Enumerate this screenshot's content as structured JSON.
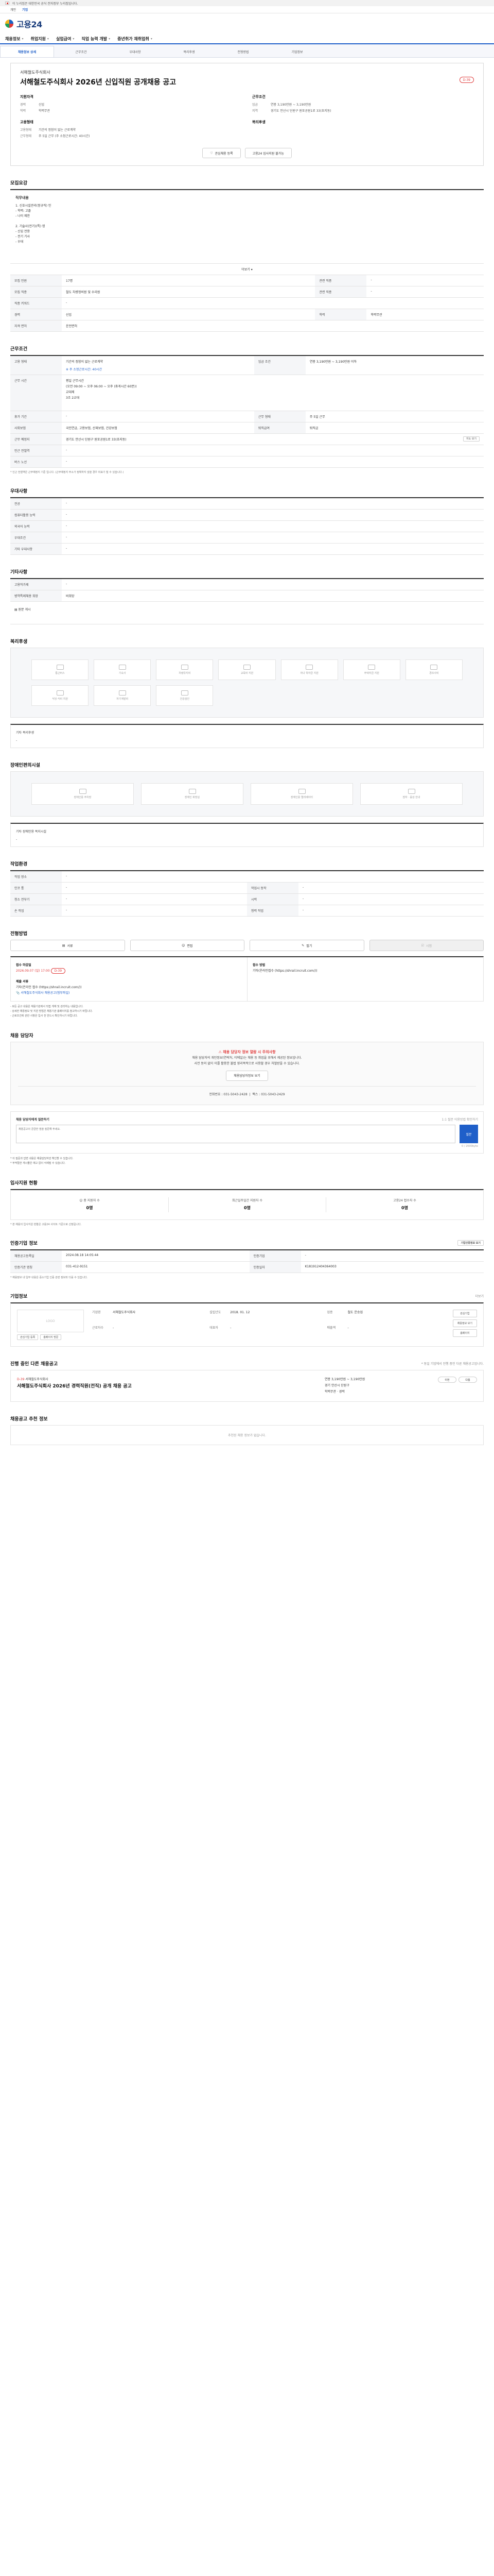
{
  "gov_banner": {
    "text": "이 누리집은 대한민국 공식 전자정부 누리집입니다."
  },
  "subnav": {
    "items": [
      "개인",
      "기업"
    ],
    "active": "기업"
  },
  "brand": {
    "name": "고용24"
  },
  "gnb": {
    "items": [
      "채용정보",
      "취업지원",
      "실업급여",
      "직업 능력 개발",
      "중년취가 재취업취"
    ]
  },
  "tabs": {
    "items": [
      "채용정보 상세",
      "근무조건",
      "우대사항",
      "복리후생",
      "전형방법",
      "기업정보"
    ],
    "active": 0
  },
  "job": {
    "company": "서해철도주식회사",
    "title": "서해철도주식회사 2026년 신입직원 공개채용 공고",
    "dday": "D-39",
    "qual_head": "지원자격",
    "cond_head": "근무조건",
    "qual": [
      {
        "k": "경력",
        "v": "신입"
      },
      {
        "k": "학력",
        "v": "학력무관"
      }
    ],
    "cond": [
      {
        "k": "임금",
        "v": "연봉 3,190만원 ~ 3,190만원"
      },
      {
        "k": "지역",
        "v": "경기도 안산시 단원구 원포공원1로 33(초지동)"
      }
    ],
    "type_head": "고용형태",
    "type": [
      {
        "k": "고용형태",
        "v": "기간의 정함이 없는 근로계약"
      },
      {
        "k": "근무형태",
        "v": "주 5일 근무 (주 소정근로시간: 40시간)"
      }
    ],
    "welfare_head": "복리후생",
    "btn_save": "관심채용 등록",
    "btn_print": "고용24 입사지원 불가능"
  },
  "recruit": {
    "title": "모집요강",
    "duty_head": "직무내용",
    "duty_lines": [
      "1. 신호시설관리(정규직) 인",
      "- 학력: 고졸",
      "- 나이 제한",
      "",
      "2. 기술사(전기)(특) 명",
      "- 신입 전용",
      "- 전기 기사",
      "- 우대"
    ],
    "more": "더보기",
    "rows": [
      {
        "k1": "모집 인원",
        "v1": "17명",
        "k2": "관련 직종",
        "v2": "-"
      },
      {
        "k1": "모집 직종",
        "v1": "철도 차량정비원 및 수리원",
        "k2": "관련 직종",
        "v2": "-"
      },
      {
        "k1": "직종 키워드",
        "v1": "-",
        "k2": "",
        "v2": ""
      },
      {
        "k1": "경력",
        "v1": "신입",
        "k2": "학력",
        "v2": "학력무관"
      },
      {
        "k1": "자격 면허",
        "v1": "운전면허",
        "k2": "",
        "v2": ""
      }
    ]
  },
  "work": {
    "title": "근무조건",
    "r1": {
      "k1": "고용 형태",
      "v1": "기간의 정함이 없는 근로계약",
      "k2": "임금 조건",
      "v2": "연봉 3,190만원 ~ 3,190만원 이하"
    },
    "r1_note": "주 소정근로시간: 40시간",
    "hours_head": "근무 시간",
    "hours_lines": [
      "평일 근무시간",
      "(오전 09:00 ~ 오후 06:00 ~ 오후 (휴게시간 60분))",
      "교대제",
      "3조 2교대"
    ],
    "rows": [
      {
        "k1": "휴가 기간",
        "v1": "-",
        "k2": "근무 형태",
        "v2": "주 5일 근무"
      },
      {
        "k1": "사회보험",
        "v1": "국민연금, 고용보험, 산재보험, 건강보험",
        "k2": "퇴직급여",
        "v2": "퇴직금"
      },
      {
        "k1": "근무 예정지",
        "v1": "경기도 안산시 단원구 원포공원1로 33(초지동)",
        "k2": "",
        "v2": ""
      },
      {
        "k1": "인근 전철역",
        "v1": "-",
        "k2": "",
        "v2": ""
      },
      {
        "k1": "버스 노선",
        "v1": "-",
        "k2": "",
        "v2": ""
      }
    ],
    "map_btn": "지도 보기",
    "note": "* 인근 전철역은 근무예정지 기준 입니다. (근무예정지 주소가 정확하지 않을 경우 미표기 될 수 있습니다.)"
  },
  "prefer": {
    "title": "우대사항",
    "rows": [
      {
        "k": "전공",
        "v": "-"
      },
      {
        "k": "컴퓨터활용 능력",
        "v": "-"
      },
      {
        "k": "외국어 능력",
        "v": "-"
      },
      {
        "k": "우대조건",
        "v": "-"
      },
      {
        "k": "기타 우대사항",
        "v": "-"
      }
    ]
  },
  "etc": {
    "title": "기타사항",
    "rows": [
      {
        "k": "고용허가제",
        "v": "-"
      },
      {
        "k": "병역특례채용 희망",
        "v": "비희망"
      }
    ],
    "link": "원문 게시"
  },
  "welfare": {
    "title": "복리후생",
    "icons": [
      "통근버스",
      "기숙사",
      "차량유지비",
      "교육비 지원",
      "자녀 학자금 지원",
      "주택자금 지원",
      "경조사비",
      "식당·식비 지원",
      "자기계발비",
      "건강검진"
    ],
    "free_head": "기타 복리후생",
    "free_val": "-"
  },
  "disabled": {
    "title": "장애인편의시설",
    "icons": [
      "장애인용 주차장",
      "장애인 화장실",
      "장애인용 엘리베이터",
      "점자 · 음성 안내"
    ],
    "free_head": "기타 장애인용 복지시설",
    "free_val": "-"
  },
  "screen": {
    "title": "작업환경",
    "rows": [
      {
        "k1": "작업 장소",
        "v1": "-",
        "k2": "",
        "v2": ""
      },
      {
        "k1": "인코 통",
        "v1": "-",
        "k2": "작업시 동작",
        "v2": "-"
      },
      {
        "k1": "청소 전부기",
        "v1": "-",
        "k2": "시력",
        "v2": "-"
      },
      {
        "k1": "손 작업",
        "v1": "-",
        "k2": "청력 작업",
        "v2": "-"
      }
    ]
  },
  "apply": {
    "title": "전형방법",
    "buttons": [
      "서류",
      "면접",
      "필기",
      "시험"
    ],
    "deadline_head": "접수 마감일",
    "deadline": "2026.09.07 (일) 17:00",
    "dday": "D-39",
    "method_head": "접수 방법",
    "method_val": "기타(온라인접수 (https://shrail.incruit.com/))",
    "doc_head": "제출 서류",
    "doc_val": "기타(온라인 접수 (https://shrail.incruit.com/))",
    "link": "서해철도주식회사 채용공고(첨부파일)",
    "bullets": [
      "- 모든 공고 내용은 채용기관에서 직접 게재 및 관리하는 내용입니다.",
      "- 상세한 채용정보 및 지원 방법은 채용기관 홈페이지를 참고하시기 바랍니다.",
      "- 근로조건에 관한 사항은 입사 전 반드시 확인하시기 바랍니다."
    ]
  },
  "manager": {
    "title": "채용 담당자",
    "notice_hd": "채용 담당자 정보 열람 시 주의사항",
    "notice_1": "채용 담당자의 개인정보(연락처, 이메일)는 채용 등 취업을 위해서 제공된 정보입니다.",
    "notice_2": "사전 동의 없이 이를 활용한 불법 영리목적으로 사용할 경우 처벌받을 수 있습니다.",
    "view_btn": "채용담당자정보 보기",
    "phone": "전화번호 : 031-5043-2428",
    "fax": "팩스 : 031-5043-2429",
    "q_head": "채용 담당자에게 질문하기",
    "q_sub": "1:1 질문 이용방법 확인하기",
    "q_placeholder": "채용공고의 궁금한 점을 질문해 주세요.",
    "q_count": "0 / 2000byte",
    "q_btn": "질문",
    "q_notes": [
      "* 이 질문과 답변 내용은 채용담당자만 확인할 수 있습니다.",
      "* 부적절한 게시물은 예고 없이 삭제될 수 있습니다."
    ]
  },
  "stats": {
    "title": "입사지원 현황",
    "items": [
      {
        "label": "총 지원자 수",
        "val": "0명"
      },
      {
        "label": "최근일주일간 지원자 수",
        "val": "0명"
      },
      {
        "label": "고용24 접수자 수",
        "val": "0명"
      }
    ],
    "note": "* 본 채용의 입사지원 현황은 고용24 사이트 기준으로 산정됩니다."
  },
  "info": {
    "title": "인증기업 정보",
    "btn": "기업인증정보 보기",
    "rows": [
      {
        "k1": "채용공고등록일",
        "v1": "2024.08.18 14:05:44",
        "k2": "인증기업",
        "v2": "-"
      },
      {
        "k1": "인증기관 명칭",
        "v1": "031-412-9151",
        "k2": "인증일자",
        "v2": "K181912404364003"
      }
    ],
    "note": "* 채용정보 내 일부 내용은 중소기업 인증 관련 정보와 다를 수 있습니다."
  },
  "company": {
    "title": "기업정보",
    "link": "더보기",
    "logo": "LOGO",
    "fields": [
      {
        "k": "기업명",
        "v": "서해철도주식회사"
      },
      {
        "k": "설립년도",
        "v": "2018. 01. 12"
      },
      {
        "k": "업종",
        "v": "철도 운송업"
      },
      {
        "k": "근로자수",
        "v": "-"
      },
      {
        "k": "대표자",
        "v": "-"
      },
      {
        "k": "매출액",
        "v": "-"
      }
    ],
    "btns": [
      "관심기업",
      "채용정보 보기",
      "홈페이지"
    ],
    "fav": "관심기업 등록",
    "visit": "홈페이지 방문"
  },
  "other": {
    "title": "진행 중인 다른 채용공고",
    "sub": "* 동일 기업에서 진행 중인 다른 채용공고입니다.",
    "dday": "D-39",
    "co": "서해철도주식회사",
    "t": "서해철도주식회사 2026년 경력직원(전직) 공개 채용 공고",
    "details": [
      "연봉 3,190만원 ~ 3,190만원",
      "경기 안산시 단원구",
      "학력무관 · 경력"
    ],
    "nav": [
      "이전",
      "다음"
    ]
  },
  "recommend": {
    "title": "채용공고 추천 정보",
    "empty": "추천된 채용 정보가 없습니다."
  }
}
